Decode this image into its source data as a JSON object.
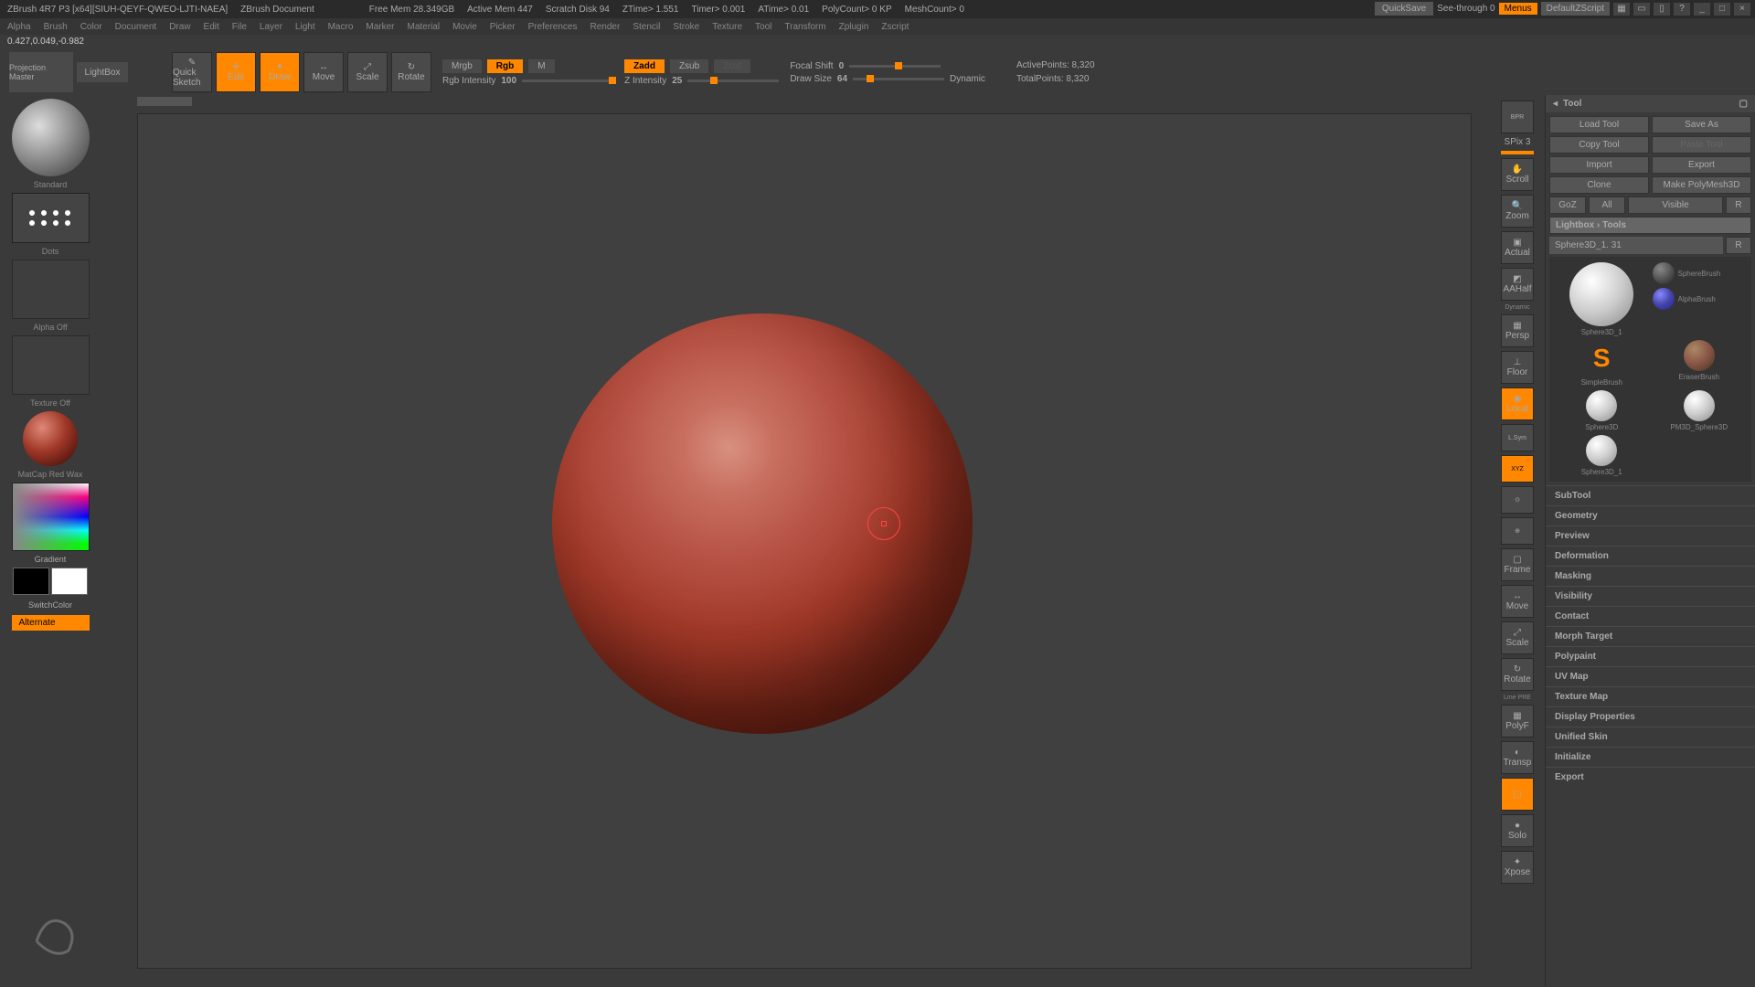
{
  "titlebar": {
    "app": "ZBrush 4R7 P3 [x64][SIUH-QEYF-QWEO-LJTI-NAEA]",
    "doc": "ZBrush Document",
    "status": [
      "Free Mem 28.349GB",
      "Active Mem 447",
      "Scratch Disk 94",
      "ZTime> 1.551",
      "Timer> 0.001",
      "ATime> 0.01",
      "PolyCount> 0 KP",
      "MeshCount> 0"
    ],
    "quicksave": "QuickSave",
    "seethrough": "See-through  0",
    "menus": "Menus",
    "script": "DefaultZScript"
  },
  "menubar": [
    "Alpha",
    "Brush",
    "Color",
    "Document",
    "Draw",
    "Edit",
    "File",
    "Layer",
    "Light",
    "Macro",
    "Marker",
    "Material",
    "Movie",
    "Picker",
    "Preferences",
    "Render",
    "Stencil",
    "Stroke",
    "Texture",
    "Tool",
    "Transform",
    "Zplugin",
    "Zscript"
  ],
  "coords": "0.427,0.049,-0.982",
  "toolbar": {
    "projection": "Projection Master",
    "lightbox": "LightBox",
    "quicksketch": "Quick Sketch",
    "edit": "Edit",
    "draw": "Draw",
    "move": "Move",
    "scale": "Scale",
    "rotate": "Rotate",
    "mrgb": "Mrgb",
    "rgb": "Rgb",
    "m": "M",
    "rgbintensity_label": "Rgb Intensity",
    "rgbintensity_val": "100",
    "zadd": "Zadd",
    "zsub": "Zsub",
    "zcut": "Zcut",
    "zintensity_label": "Z Intensity",
    "zintensity_val": "25",
    "focalshift_label": "Focal Shift",
    "focalshift_val": "0",
    "drawsize_label": "Draw Size",
    "drawsize_val": "64",
    "dynamic": "Dynamic",
    "activepoints": "ActivePoints: 8,320",
    "totalpoints": "TotalPoints: 8,320"
  },
  "left": {
    "standard": "Standard",
    "dots": "Dots",
    "alphaoff": "Alpha Off",
    "textureoff": "Texture Off",
    "matcap": "MatCap Red Wax",
    "gradient": "Gradient",
    "switchcolor": "SwitchColor",
    "alternate": "Alternate"
  },
  "rtools": {
    "spix": "SPix 3",
    "items": [
      "BPR",
      "Scroll",
      "Zoom",
      "Actual",
      "AAHalf",
      "Persp",
      "Floor",
      "Local",
      "L.Sym",
      "XYZ",
      "Frame",
      "Move",
      "Scale",
      "Rotate",
      "PolyF",
      "Transp",
      "Solo",
      "Xpose"
    ],
    "dynamic": "Dynamic",
    "lmgpre": "Lme PRE"
  },
  "rpanel": {
    "header": "Tool",
    "loadtool": "Load Tool",
    "saveas": "Save As",
    "copytool": "Copy Tool",
    "pastetool": "Paste Tool",
    "import": "Import",
    "export": "Export",
    "clone": "Clone",
    "makepolymesh": "Make PolyMesh3D",
    "goz": "GoZ",
    "all": "All",
    "visible": "Visible",
    "r": "R",
    "lightboxtools": "Lightbox › Tools",
    "currenttool": "Sphere3D_1. 31",
    "toolslots": [
      "Sphere3D_1",
      "SphereBrush",
      "AlphaBrush",
      "SimpleBrush",
      "EraserBrush",
      "Sphere3D",
      "PM3D_Sphere3D",
      "Sphere3D_1"
    ],
    "accordion": [
      "SubTool",
      "Geometry",
      "Preview",
      "Deformation",
      "Masking",
      "Visibility",
      "Contact",
      "Morph Target",
      "Polypaint",
      "UV Map",
      "Texture Map",
      "Display Properties",
      "Unified Skin",
      "Initialize",
      "Export"
    ]
  }
}
